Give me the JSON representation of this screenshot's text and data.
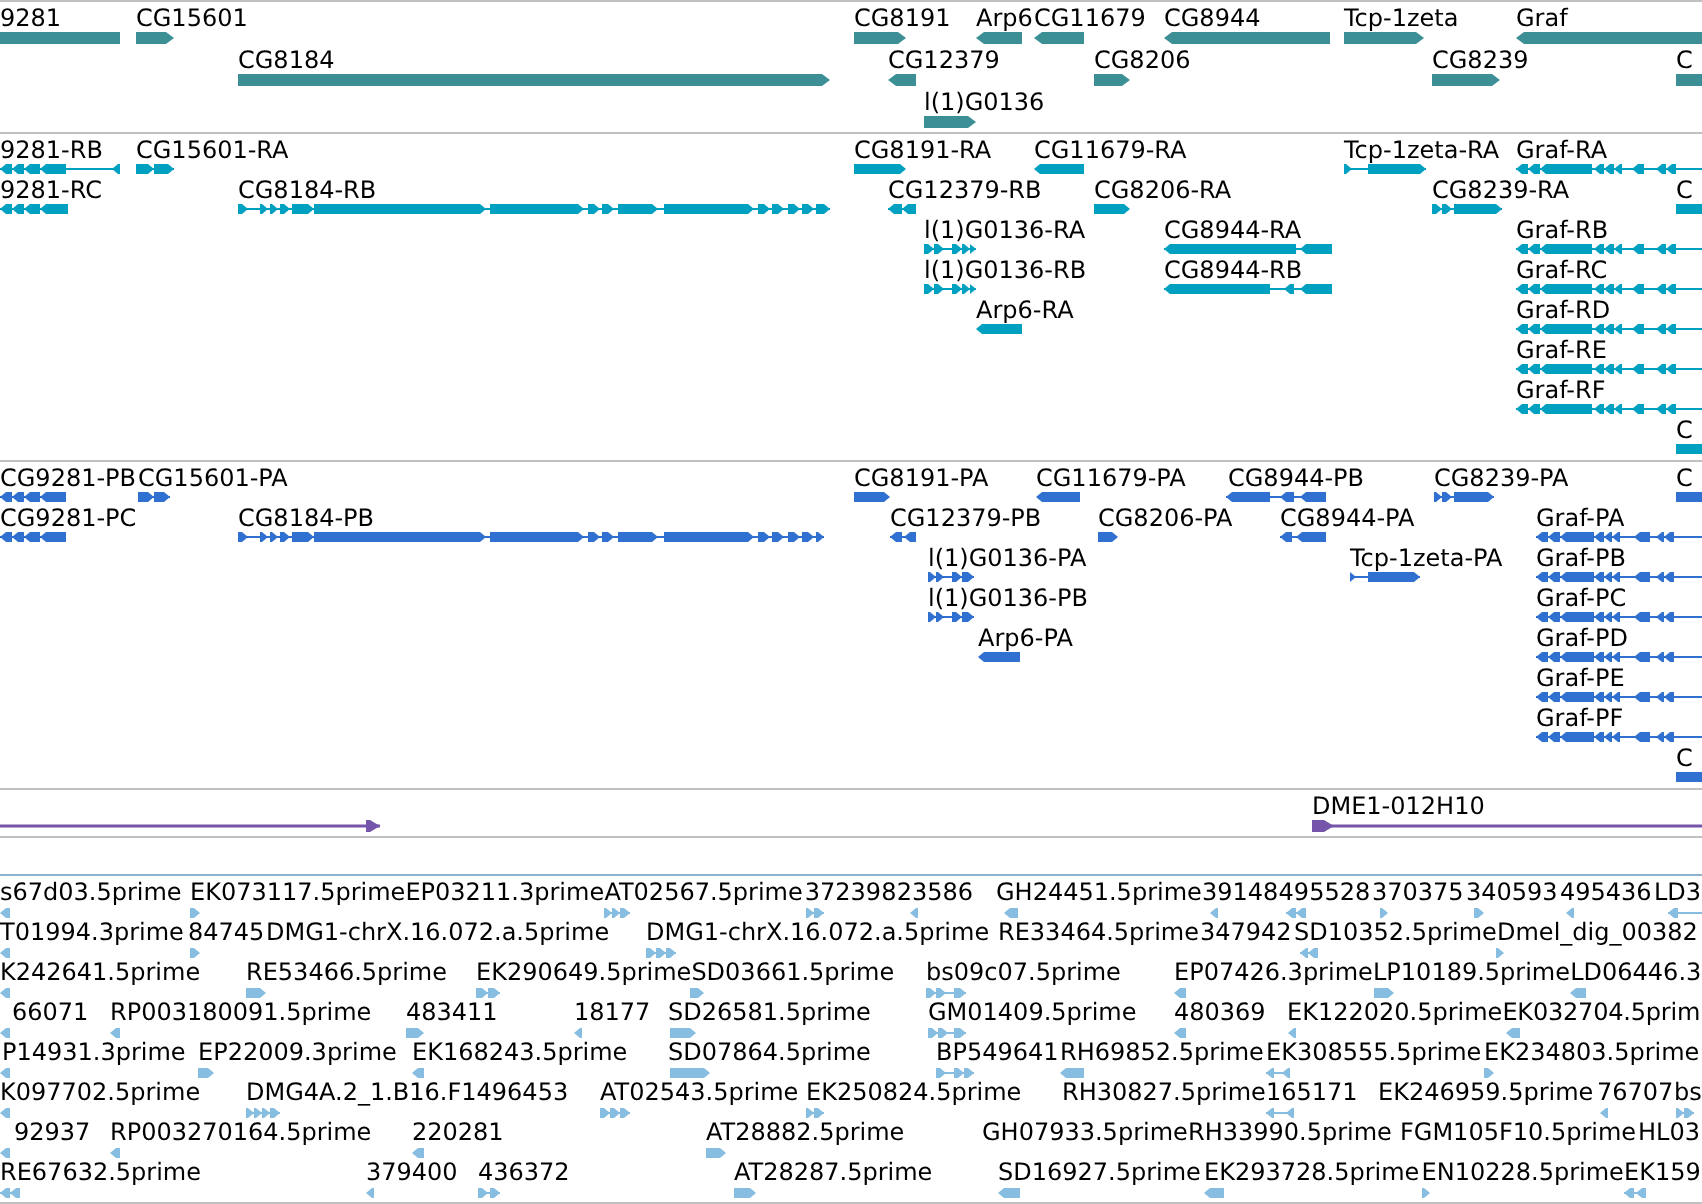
{
  "tracks": [
    {
      "kind": "gene",
      "lanes": [
        {
          "features": [
            {
              "label": "9281"
            },
            {
              "label": "CG15601",
              "reverse": false
            },
            {
              "label": "CG8191",
              "reverse": false
            },
            {
              "label": "Arp6",
              "reverse": true
            },
            {
              "label": "CG11679",
              "reverse": true
            },
            {
              "label": "CG8944",
              "reverse": true
            },
            {
              "label": "Tcp-1zeta",
              "reverse": false
            },
            {
              "label": "Graf",
              "reverse": true
            }
          ]
        },
        {
          "features": [
            {
              "label": "CG8184",
              "reverse": false
            },
            {
              "label": "CG12379",
              "reverse": true
            },
            {
              "label": "CG8206",
              "reverse": false
            },
            {
              "label": "CG8239",
              "reverse": false
            },
            {
              "label": "C"
            }
          ]
        },
        {
          "features": [
            {
              "label": "l(1)G0136",
              "reverse": false
            }
          ]
        }
      ]
    },
    {
      "kind": "transcript",
      "lanes": [
        {
          "features": [
            {
              "label": "9281-RB",
              "reverse": true
            },
            {
              "label": "CG15601-RA",
              "reverse": false
            },
            {
              "label": "CG8191-RA",
              "reverse": false
            },
            {
              "label": "CG11679-RA",
              "reverse": true
            },
            {
              "label": "Tcp-1zeta-RA",
              "reverse": false
            },
            {
              "label": "Graf-RA",
              "reverse": true
            }
          ]
        },
        {
          "features": [
            {
              "label": "9281-RC",
              "reverse": true
            },
            {
              "label": "CG8184-RB",
              "reverse": false
            },
            {
              "label": "CG12379-RB",
              "reverse": true
            },
            {
              "label": "CG8206-RA",
              "reverse": false
            },
            {
              "label": "CG8239-RA",
              "reverse": false
            },
            {
              "label": "C"
            }
          ]
        },
        {
          "features": [
            {
              "label": "l(1)G0136-RA",
              "reverse": false
            },
            {
              "label": "CG8944-RA",
              "reverse": true
            },
            {
              "label": "Graf-RB",
              "reverse": true
            }
          ]
        },
        {
          "features": [
            {
              "label": "l(1)G0136-RB",
              "reverse": false
            },
            {
              "label": "CG8944-RB",
              "reverse": true
            },
            {
              "label": "Graf-RC",
              "reverse": true
            }
          ]
        },
        {
          "features": [
            {
              "label": "Arp6-RA",
              "reverse": true
            },
            {
              "label": "Graf-RD",
              "reverse": true
            }
          ]
        },
        {
          "features": [
            {
              "label": "Graf-RE",
              "reverse": true
            }
          ]
        },
        {
          "features": [
            {
              "label": "Graf-RF",
              "reverse": true
            }
          ]
        },
        {
          "features": [
            {
              "label": "C"
            }
          ]
        }
      ]
    },
    {
      "kind": "protein",
      "lanes": [
        {
          "features": [
            {
              "label": "CG9281-PB",
              "reverse": true
            },
            {
              "label": "CG15601-PA",
              "reverse": false
            },
            {
              "label": "CG8191-PA",
              "reverse": false
            },
            {
              "label": "CG11679-PA",
              "reverse": true
            },
            {
              "label": "CG8944-PB",
              "reverse": true
            },
            {
              "label": "CG8239-PA",
              "reverse": false
            },
            {
              "label": "C"
            }
          ]
        },
        {
          "features": [
            {
              "label": "CG9281-PC",
              "reverse": true
            },
            {
              "label": "CG8184-PB",
              "reverse": false
            },
            {
              "label": "CG12379-PB",
              "reverse": true
            },
            {
              "label": "CG8206-PA",
              "reverse": false
            },
            {
              "label": "CG8944-PA",
              "reverse": true
            },
            {
              "label": "Graf-PA",
              "reverse": true
            }
          ]
        },
        {
          "features": [
            {
              "label": "l(1)G0136-PA",
              "reverse": false
            },
            {
              "label": "Tcp-1zeta-PA",
              "reverse": false
            },
            {
              "label": "Graf-PB",
              "reverse": true
            }
          ]
        },
        {
          "features": [
            {
              "label": "l(1)G0136-PB",
              "reverse": false
            },
            {
              "label": "Graf-PC",
              "reverse": true
            }
          ]
        },
        {
          "features": [
            {
              "label": "Arp6-PA",
              "reverse": true
            },
            {
              "label": "Graf-PD",
              "reverse": true
            }
          ]
        },
        {
          "features": [
            {
              "label": "Graf-PE",
              "reverse": true
            }
          ]
        },
        {
          "features": [
            {
              "label": "Graf-PF",
              "reverse": true
            }
          ]
        },
        {
          "features": [
            {
              "label": "C"
            }
          ]
        }
      ]
    },
    {
      "kind": "clone",
      "lanes": [
        {
          "features": [
            {
              "reverse": false
            },
            {
              "label": "DME1-012H10",
              "reverse": false
            }
          ]
        }
      ]
    },
    {
      "kind": "est",
      "lanes": [
        {
          "features": [
            {
              "label": "s67d03.5prime",
              "reverse": true
            },
            {
              "label": "EK073117.5prime",
              "reverse": false
            },
            {
              "label": "EP03211.3prime"
            },
            {
              "label": "AT02567.5prime",
              "reverse": false
            },
            {
              "label": "372398",
              "reverse": false
            },
            {
              "label": "23586",
              "reverse": true
            },
            {
              "label": "GH24451.5prime",
              "reverse": true
            },
            {
              "label": "39148",
              "reverse": true
            },
            {
              "label": "495528",
              "reverse": true
            },
            {
              "label": "370375",
              "reverse": false
            },
            {
              "label": "340593",
              "reverse": false
            },
            {
              "label": "495436",
              "reverse": true
            },
            {
              "label": "LD3",
              "reverse": true
            }
          ]
        },
        {
          "features": [
            {
              "label": "T01994.3prime",
              "reverse": true
            },
            {
              "label": "84745",
              "reverse": false
            },
            {
              "label": "DMG1-chrX.16.072.a.5prime"
            },
            {
              "label": "DMG1-chrX.16.072.a.5prime",
              "reverse": false
            },
            {
              "label": "RE33464.5prime"
            },
            {
              "label": "347942"
            },
            {
              "label": "SD10352.5prime",
              "reverse": true
            },
            {
              "label": "Dmel_dig_00382",
              "reverse": false
            }
          ]
        },
        {
          "features": [
            {
              "label": "K242641.5prime",
              "reverse": true
            },
            {
              "label": "RE53466.5prime",
              "reverse": false
            },
            {
              "label": "EK290649.5prime",
              "reverse": false
            },
            {
              "label": "SD03661.5prime",
              "reverse": false
            },
            {
              "label": "bs09c07.5prime",
              "reverse": false
            },
            {
              "label": "EP07426.3prime",
              "reverse": true
            },
            {
              "label": "LP10189.5prime",
              "reverse": false
            },
            {
              "label": "LD06446.3",
              "reverse": true
            }
          ]
        },
        {
          "features": [
            {
              "label": "66071",
              "reverse": true
            },
            {
              "label": "RP003180091.5prime",
              "reverse": true
            },
            {
              "label": "483411",
              "reverse": false
            },
            {
              "label": "18177",
              "reverse": true
            },
            {
              "label": "SD26581.5prime",
              "reverse": false
            },
            {
              "label": "GM01409.5prime",
              "reverse": false
            },
            {
              "label": "480369",
              "reverse": true
            },
            {
              "label": "EK122020.5prime",
              "reverse": true
            },
            {
              "label": "EK032704.5prim",
              "reverse": true
            }
          ]
        },
        {
          "features": [
            {
              "label": "P14931.3prime",
              "reverse": true
            },
            {
              "label": "EP22009.3prime",
              "reverse": false
            },
            {
              "label": "EK168243.5prime",
              "reverse": true
            },
            {
              "label": "SD07864.5prime",
              "reverse": false
            },
            {
              "label": "BP549641",
              "reverse": false
            },
            {
              "label": "RH69852.5prime",
              "reverse": true
            },
            {
              "label": "EK308555.5prime",
              "reverse": true
            },
            {
              "label": "EK234803.5prime",
              "reverse": false
            }
          ]
        },
        {
          "features": [
            {
              "label": "K097702.5prime",
              "reverse": true
            },
            {
              "label": "DMG4A.2_1.B16.F1496453",
              "reverse": false
            },
            {
              "label": "AT02543.5prime",
              "reverse": false
            },
            {
              "label": "EK250824.5prime",
              "reverse": false
            },
            {
              "label": "RH30827.5prime"
            },
            {
              "label": "165171",
              "reverse": true
            },
            {
              "label": "EK246959.5prime"
            },
            {
              "label": "76707",
              "reverse": true
            },
            {
              "label": "bs",
              "reverse": false
            }
          ]
        },
        {
          "features": [
            {
              "label": "92937",
              "reverse": true
            },
            {
              "label": "RP003270164.5prime",
              "reverse": true
            },
            {
              "label": "220281",
              "reverse": true
            },
            {
              "label": "AT28882.5prime",
              "reverse": false
            },
            {
              "label": "GH07933.5prime"
            },
            {
              "label": "RH33990.5prime"
            },
            {
              "label": "FGM105F10.5prime"
            },
            {
              "label": "HL03"
            }
          ]
        },
        {
          "features": [
            {
              "label": "RE67632.5prime",
              "reverse": true
            },
            {
              "label": "379400",
              "reverse": true
            },
            {
              "label": "436372",
              "reverse": false
            },
            {
              "label": "AT28287.5prime",
              "reverse": false
            },
            {
              "label": "SD16927.5prime",
              "reverse": true
            },
            {
              "label": "EK293728.5prime",
              "reverse": true
            },
            {
              "label": "EN10228.5prime",
              "reverse": false
            },
            {
              "label": "EK159",
              "reverse": true
            }
          ]
        }
      ]
    }
  ]
}
